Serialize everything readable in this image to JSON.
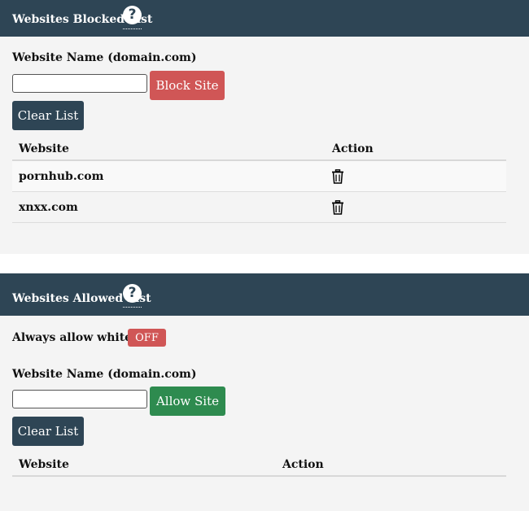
{
  "blocked": {
    "title": "Websites Blocked List",
    "field_label": "Website Name (domain.com)",
    "input_value": "",
    "block_button": "Block Site",
    "clear_button": "Clear List",
    "columns": [
      "Website",
      "Action"
    ],
    "rows": [
      {
        "website": "pornhub.com",
        "action_icon": "trash-icon"
      },
      {
        "website": "xnxx.com",
        "action_icon": "trash-icon"
      }
    ]
  },
  "allowed": {
    "title": "Websites Allowed List",
    "whitelist_label": "Always allow whitelist:",
    "whitelist_state": "OFF",
    "field_label": "Website Name (domain.com)",
    "input_value": "",
    "allow_button": "Allow Site",
    "clear_button": "Clear List",
    "columns": [
      "Website",
      "Action"
    ],
    "rows": []
  },
  "colors": {
    "header_bg": "#2e4555",
    "panel_bg": "#f4f4f4",
    "danger": "#d05656",
    "success": "#2e8b4f"
  }
}
